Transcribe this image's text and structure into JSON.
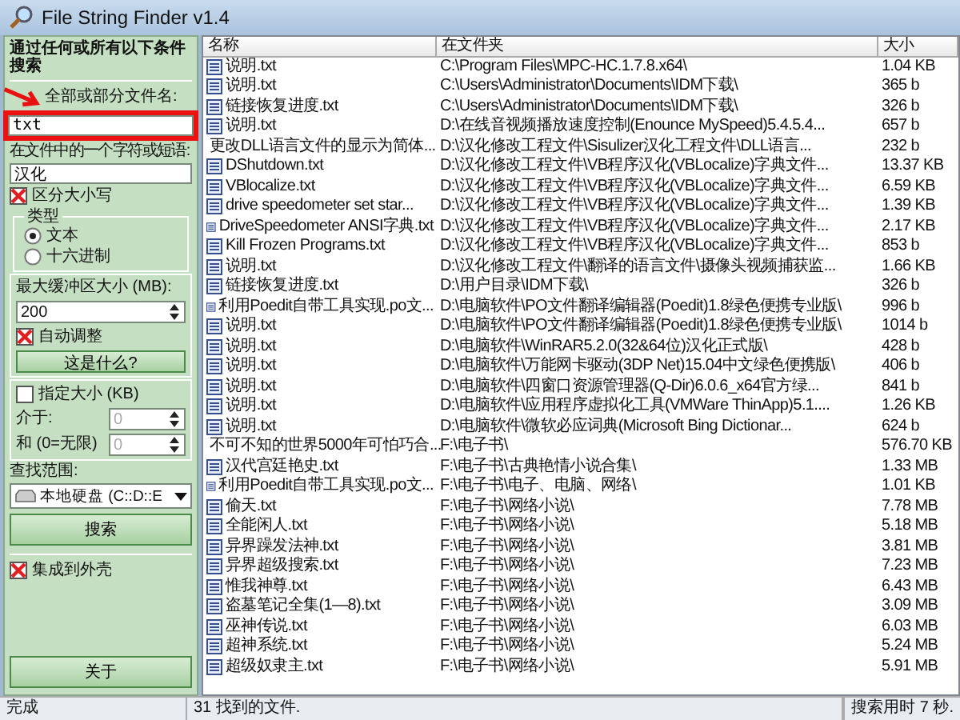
{
  "window": {
    "title": "File String Finder v1.4"
  },
  "search_panel": {
    "heading": "通过任何或所有以下条件搜索",
    "filename_label": "全部或部分文件名:",
    "filename_value": "txt",
    "filename_highlighted": true,
    "phrase_label": "在文件中的一个字符或短语:",
    "phrase_value": "汉化",
    "case_sensitive": {
      "label": "区分大小写",
      "checked": true
    },
    "type_group": {
      "title": "类型",
      "options": [
        {
          "label": "文本",
          "selected": true
        },
        {
          "label": "十六进制",
          "selected": false
        }
      ]
    },
    "buffer": {
      "label": "最大缓冲区大小 (MB):",
      "value": "200",
      "auto_adjust": {
        "label": "自动调整",
        "checked": true
      },
      "help_button": "这是什么?"
    },
    "size_filter": {
      "label": "指定大小 (KB)",
      "checked": false,
      "min_label": "介于:",
      "min_value": "0",
      "max_label": "和 (0=无限)",
      "max_value": "0"
    },
    "scope_label": "查找范围:",
    "scope_value": "本地硬盘 (C::D::E",
    "search_button": "搜索",
    "shell_integration": {
      "label": "集成到外壳",
      "checked": true
    },
    "about_button": "关于"
  },
  "table": {
    "columns": [
      "名称",
      "在文件夹",
      "大小"
    ],
    "rows": [
      [
        "说明.txt",
        "C:\\Program Files\\MPC-HC.1.7.8.x64\\",
        "1.04 KB"
      ],
      [
        "说明.txt",
        "C:\\Users\\Administrator\\Documents\\IDM下载\\",
        "365 b"
      ],
      [
        "链接恢复进度.txt",
        "C:\\Users\\Administrator\\Documents\\IDM下载\\",
        "326 b"
      ],
      [
        "说明.txt",
        "D:\\在线音视频播放速度控制(Enounce MySpeed)5.4.5.4...",
        "657 b"
      ],
      [
        "更改DLL语言文件的显示为简体...",
        "D:\\汉化修改工程文件\\Sisulizer汉化工程文件\\DLL语言...",
        "232 b"
      ],
      [
        "DShutdown.txt",
        "D:\\汉化修改工程文件\\VB程序汉化(VBLocalize)字典文件...",
        "13.37 KB"
      ],
      [
        "VBlocalize.txt",
        "D:\\汉化修改工程文件\\VB程序汉化(VBLocalize)字典文件...",
        "6.59 KB"
      ],
      [
        "drive speedometer set star...",
        "D:\\汉化修改工程文件\\VB程序汉化(VBLocalize)字典文件...",
        "1.39 KB"
      ],
      [
        "DriveSpeedometer ANSI字典.txt",
        "D:\\汉化修改工程文件\\VB程序汉化(VBLocalize)字典文件...",
        "2.17 KB"
      ],
      [
        "Kill Frozen Programs.txt",
        "D:\\汉化修改工程文件\\VB程序汉化(VBLocalize)字典文件...",
        "853 b"
      ],
      [
        "说明.txt",
        "D:\\汉化修改工程文件\\翻译的语言文件\\摄像头视频捕获监...",
        "1.66 KB"
      ],
      [
        "链接恢复进度.txt",
        "D:\\用户目录\\IDM下载\\",
        "326 b"
      ],
      [
        "利用Poedit自带工具实现.po文...",
        "D:\\电脑软件\\PO文件翻译编辑器(Poedit)1.8绿色便携专业版\\",
        "996 b"
      ],
      [
        "说明.txt",
        "D:\\电脑软件\\PO文件翻译编辑器(Poedit)1.8绿色便携专业版\\",
        "1014 b"
      ],
      [
        "说明.txt",
        "D:\\电脑软件\\WinRAR5.2.0(32&64位)汉化正式版\\",
        "428 b"
      ],
      [
        "说明.txt",
        "D:\\电脑软件\\万能网卡驱动(3DP Net)15.04中文绿色便携版\\",
        "406 b"
      ],
      [
        "说明.txt",
        "D:\\电脑软件\\四窗口资源管理器(Q-Dir)6.0.6_x64官方绿...",
        "841 b"
      ],
      [
        "说明.txt",
        "D:\\电脑软件\\应用程序虚拟化工具(VMWare ThinApp)5.1....",
        "1.26 KB"
      ],
      [
        "说明.txt",
        "D:\\电脑软件\\微软必应词典(Microsoft Bing Dictionar...",
        "624 b"
      ],
      [
        "不可不知的世界5000年可怕巧合...",
        "F:\\电子书\\",
        "576.70 KB"
      ],
      [
        "汉代宫廷艳史.txt",
        "F:\\电子书\\古典艳情小说合集\\",
        "1.33 MB"
      ],
      [
        "利用Poedit自带工具实现.po文...",
        "F:\\电子书\\电子、电脑、网络\\",
        "1.01 KB"
      ],
      [
        "偷天.txt",
        "F:\\电子书\\网络小说\\",
        "7.78 MB"
      ],
      [
        "全能闲人.txt",
        "F:\\电子书\\网络小说\\",
        "5.18 MB"
      ],
      [
        "异界躁发法神.txt",
        "F:\\电子书\\网络小说\\",
        "3.81 MB"
      ],
      [
        "异界超级搜索.txt",
        "F:\\电子书\\网络小说\\",
        "7.23 MB"
      ],
      [
        "惟我神尊.txt",
        "F:\\电子书\\网络小说\\",
        "6.43 MB"
      ],
      [
        "盗墓笔记全集(1—8).txt",
        "F:\\电子书\\网络小说\\",
        "3.09 MB"
      ],
      [
        "巫神传说.txt",
        "F:\\电子书\\网络小说\\",
        "6.03 MB"
      ],
      [
        "超神系统.txt",
        "F:\\电子书\\网络小说\\",
        "5.24 MB"
      ],
      [
        "超级奴隶主.txt",
        "F:\\电子书\\网络小说\\",
        "5.91 MB"
      ]
    ]
  },
  "status_bar": [
    "完成",
    "31 找到的文件.",
    "搜索用时 7 秒."
  ]
}
